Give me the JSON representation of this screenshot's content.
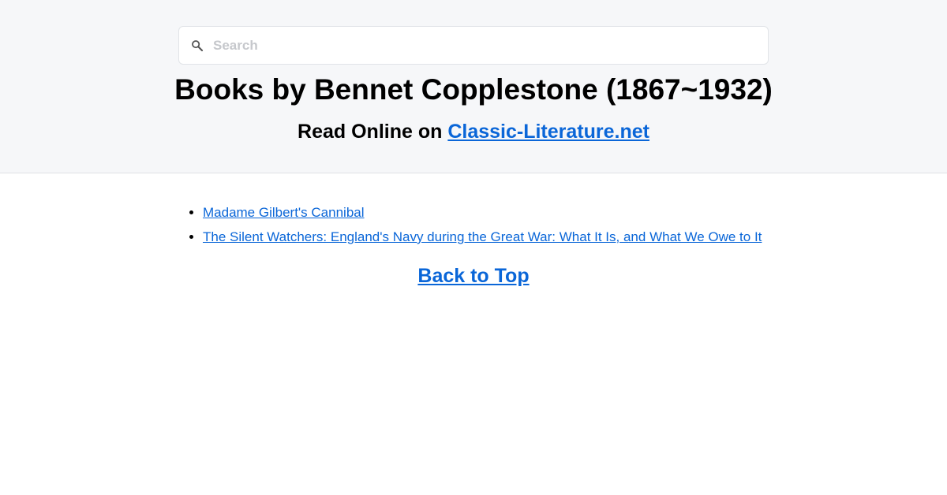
{
  "search": {
    "placeholder": "Search",
    "value": "",
    "icon": "search-icon"
  },
  "header": {
    "title": "Books by Bennet Copplestone (1867~1932)",
    "subtitle_prefix": "Read Online on ",
    "site_link": "Classic-Literature.net"
  },
  "books": [
    "Madame Gilbert's Cannibal",
    "The Silent Watchers: England's Navy during the Great War: What It Is, and What We Owe to It"
  ],
  "back_to_top": "Back to Top",
  "colors": {
    "link": "#0a66d8",
    "header_bg": "#f6f7f9",
    "page_bg": "#ffffff"
  }
}
